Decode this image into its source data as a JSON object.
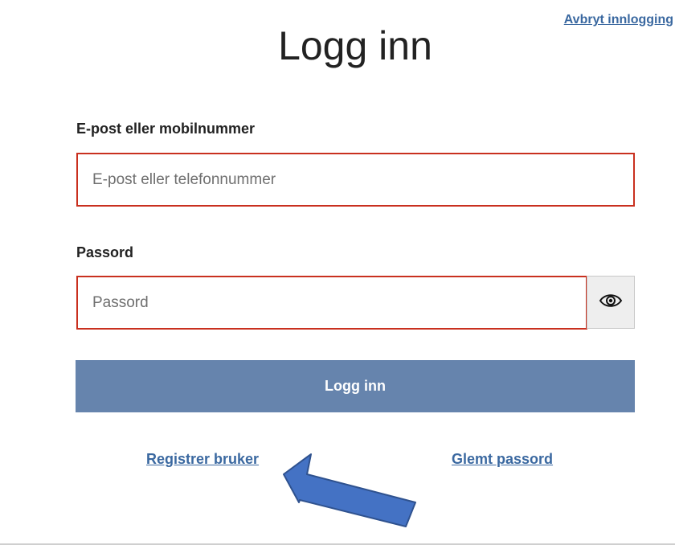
{
  "header": {
    "cancel_link": "Avbryt innlogging",
    "title": "Logg inn"
  },
  "form": {
    "email_label": "E-post eller mobilnummer",
    "email_placeholder": "E-post eller telefonnummer",
    "email_value": "",
    "password_label": "Passord",
    "password_placeholder": "Passord",
    "password_value": "",
    "show_password_icon": "eye-icon",
    "submit_label": "Logg inn"
  },
  "links": {
    "register": "Registrer bruker",
    "forgot_password": "Glemt passord"
  },
  "annotation": {
    "arrow_icon": "blue-arrow",
    "arrow_color": "#4472c4",
    "arrow_outline": "#2f528f"
  },
  "colors": {
    "link": "#3a68a0",
    "button": "#6684ad",
    "error_border": "#c9301f"
  }
}
